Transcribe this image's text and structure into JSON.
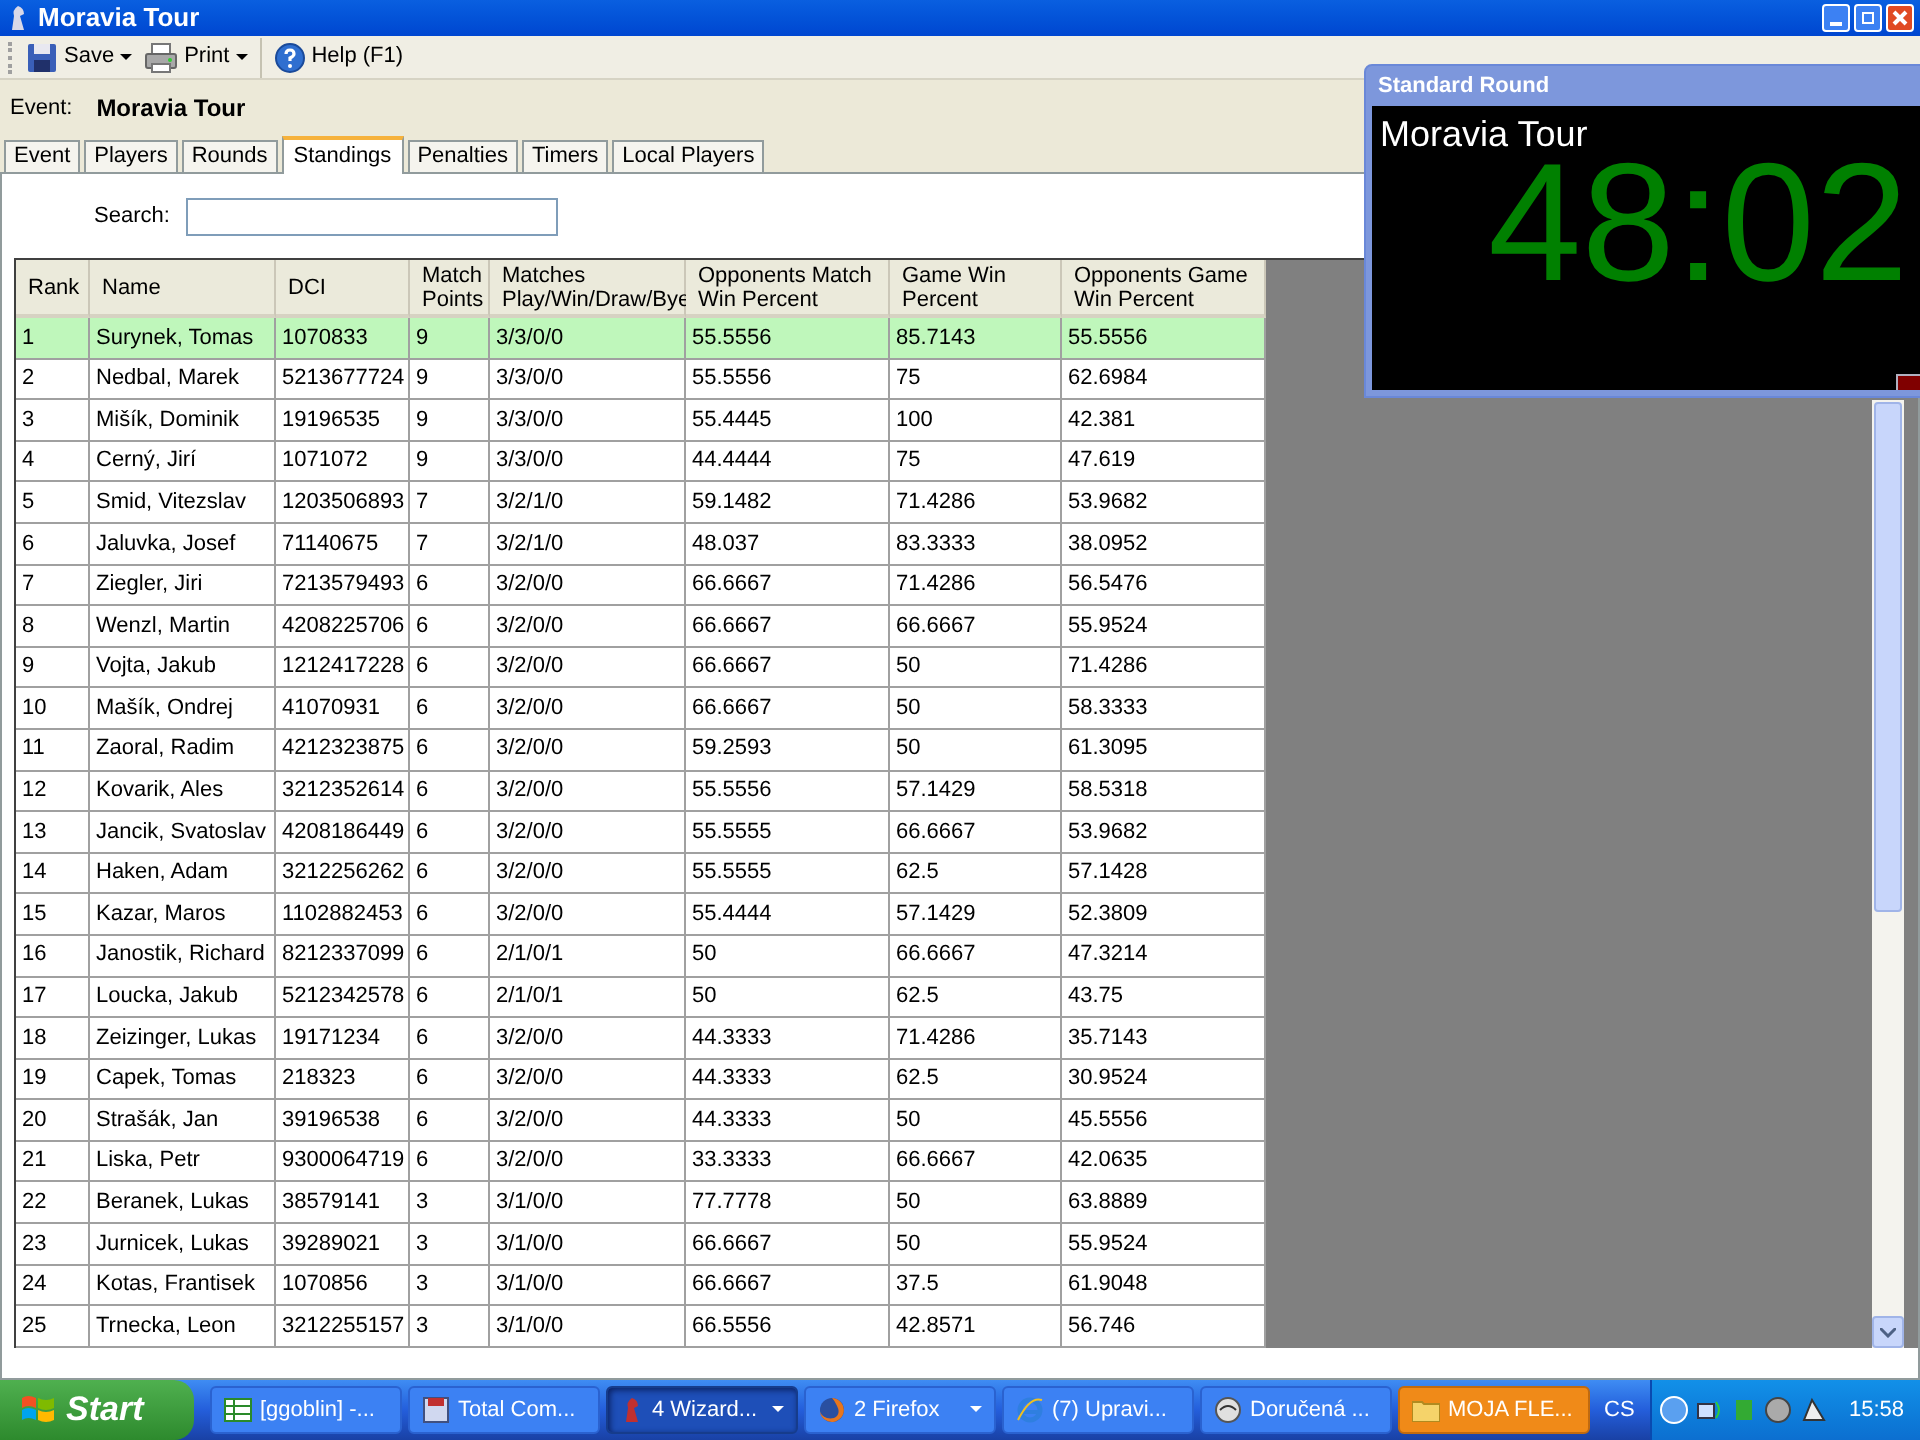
{
  "window": {
    "title": "Moravia Tour"
  },
  "toolbar": [
    {
      "label": "Save",
      "kind": "save",
      "dropdown": true
    },
    {
      "label": "Print",
      "kind": "print",
      "dropdown": true
    },
    {
      "label": "Help (F1)",
      "kind": "help",
      "dropdown": false
    }
  ],
  "event": {
    "label": "Event:",
    "value": "Moravia Tour"
  },
  "tabs": [
    {
      "label": "Event",
      "selected": false
    },
    {
      "label": "Players",
      "selected": false
    },
    {
      "label": "Rounds",
      "selected": false
    },
    {
      "label": "Standings",
      "selected": true
    },
    {
      "label": "Penalties",
      "selected": false
    },
    {
      "label": "Timers",
      "selected": false
    },
    {
      "label": "Local Players",
      "selected": false
    }
  ],
  "search": {
    "label": "Search:"
  },
  "table": {
    "columns": [
      "Rank",
      "Name",
      "DCI",
      "Match Points",
      "Matches Play/Win/Draw/Bye",
      "Opponents Match Win Percent",
      "Game Win Percent",
      "Opponents Game Win Percent"
    ],
    "rows": [
      {
        "cells": [
          "1",
          "Surynek, Tomas",
          "1070833",
          "9",
          "3/3/0/0",
          "55.5556",
          "85.7143",
          "55.5556"
        ],
        "selected": true
      },
      {
        "cells": [
          "2",
          "Nedbal, Marek",
          "5213677724",
          "9",
          "3/3/0/0",
          "55.5556",
          "75",
          "62.6984"
        ],
        "selected": false
      },
      {
        "cells": [
          "3",
          "Mišík, Dominik",
          "19196535",
          "9",
          "3/3/0/0",
          "55.4445",
          "100",
          "42.381"
        ],
        "selected": false
      },
      {
        "cells": [
          "4",
          "Cerný, Jirí",
          "1071072",
          "9",
          "3/3/0/0",
          "44.4444",
          "75",
          "47.619"
        ],
        "selected": false
      },
      {
        "cells": [
          "5",
          "Smid, Vitezslav",
          "1203506893",
          "7",
          "3/2/1/0",
          "59.1482",
          "71.4286",
          "53.9682"
        ],
        "selected": false
      },
      {
        "cells": [
          "6",
          "Jaluvka, Josef",
          "71140675",
          "7",
          "3/2/1/0",
          "48.037",
          "83.3333",
          "38.0952"
        ],
        "selected": false
      },
      {
        "cells": [
          "7",
          "Ziegler, Jiri",
          "7213579493",
          "6",
          "3/2/0/0",
          "66.6667",
          "71.4286",
          "56.5476"
        ],
        "selected": false
      },
      {
        "cells": [
          "8",
          "Wenzl, Martin",
          "4208225706",
          "6",
          "3/2/0/0",
          "66.6667",
          "66.6667",
          "55.9524"
        ],
        "selected": false
      },
      {
        "cells": [
          "9",
          "Vojta, Jakub",
          "1212417228",
          "6",
          "3/2/0/0",
          "66.6667",
          "50",
          "71.4286"
        ],
        "selected": false
      },
      {
        "cells": [
          "10",
          "Mašík, Ondrej",
          "41070931",
          "6",
          "3/2/0/0",
          "66.6667",
          "50",
          "58.3333"
        ],
        "selected": false
      },
      {
        "cells": [
          "11",
          "Zaoral, Radim",
          "4212323875",
          "6",
          "3/2/0/0",
          "59.2593",
          "50",
          "61.3095"
        ],
        "selected": false
      },
      {
        "cells": [
          "12",
          "Kovarik, Ales",
          "3212352614",
          "6",
          "3/2/0/0",
          "55.5556",
          "57.1429",
          "58.5318"
        ],
        "selected": false
      },
      {
        "cells": [
          "13",
          "Jancik, Svatoslav",
          "4208186449",
          "6",
          "3/2/0/0",
          "55.5555",
          "66.6667",
          "53.9682"
        ],
        "selected": false
      },
      {
        "cells": [
          "14",
          "Haken, Adam",
          "3212256262",
          "6",
          "3/2/0/0",
          "55.5555",
          "62.5",
          "57.1428"
        ],
        "selected": false
      },
      {
        "cells": [
          "15",
          "Kazar, Maros",
          "1102882453",
          "6",
          "3/2/0/0",
          "55.4444",
          "57.1429",
          "52.3809"
        ],
        "selected": false
      },
      {
        "cells": [
          "16",
          "Janostik, Richard",
          "8212337099",
          "6",
          "2/1/0/1",
          "50",
          "66.6667",
          "47.3214"
        ],
        "selected": false
      },
      {
        "cells": [
          "17",
          "Loucka, Jakub",
          "5212342578",
          "6",
          "2/1/0/1",
          "50",
          "62.5",
          "43.75"
        ],
        "selected": false
      },
      {
        "cells": [
          "18",
          "Zeizinger, Lukas",
          "19171234",
          "6",
          "3/2/0/0",
          "44.3333",
          "71.4286",
          "35.7143"
        ],
        "selected": false
      },
      {
        "cells": [
          "19",
          "Capek, Tomas",
          "218323",
          "6",
          "3/2/0/0",
          "44.3333",
          "62.5",
          "30.9524"
        ],
        "selected": false
      },
      {
        "cells": [
          "20",
          "Strašák, Jan",
          "39196538",
          "6",
          "3/2/0/0",
          "44.3333",
          "50",
          "45.5556"
        ],
        "selected": false
      },
      {
        "cells": [
          "21",
          "Liska, Petr",
          "9300064719",
          "6",
          "3/2/0/0",
          "33.3333",
          "66.6667",
          "42.0635"
        ],
        "selected": false
      },
      {
        "cells": [
          "22",
          "Beranek, Lukas",
          "38579141",
          "3",
          "3/1/0/0",
          "77.7778",
          "50",
          "63.8889"
        ],
        "selected": false
      },
      {
        "cells": [
          "23",
          "Jurnicek, Lukas",
          "39289021",
          "3",
          "3/1/0/0",
          "66.6667",
          "50",
          "55.9524"
        ],
        "selected": false
      },
      {
        "cells": [
          "24",
          "Kotas, Frantisek",
          "1070856",
          "3",
          "3/1/0/0",
          "66.6667",
          "37.5",
          "61.9048"
        ],
        "selected": false
      },
      {
        "cells": [
          "25",
          "Trnecka, Leon",
          "3212255157",
          "3",
          "3/1/0/0",
          "66.5556",
          "42.8571",
          "56.746"
        ],
        "selected": false
      }
    ]
  },
  "timer_window": {
    "title": "Standard Round",
    "event": "Moravia Tour",
    "time": "48:02"
  },
  "taskbar": {
    "start": "Start",
    "tasks": [
      {
        "label": "[ggoblin] -...",
        "kind": "sheet",
        "selected": false,
        "flashing": false,
        "dropdown": false
      },
      {
        "label": "Total Com...",
        "kind": "disk",
        "selected": false,
        "flashing": false,
        "dropdown": false
      },
      {
        "label": "4 Wizard...",
        "kind": "app",
        "selected": true,
        "flashing": false,
        "dropdown": true
      },
      {
        "label": "2 Firefox",
        "kind": "firefox",
        "selected": false,
        "flashing": false,
        "dropdown": true
      },
      {
        "label": "(7) Upravi...",
        "kind": "ie",
        "selected": false,
        "flashing": false,
        "dropdown": false
      },
      {
        "label": "Doručená ...",
        "kind": "mail",
        "selected": false,
        "flashing": false,
        "dropdown": false
      },
      {
        "label": "MOJA FLE...",
        "kind": "folder",
        "selected": false,
        "flashing": true,
        "dropdown": false
      }
    ],
    "language": "CS",
    "clock": "15:58"
  }
}
